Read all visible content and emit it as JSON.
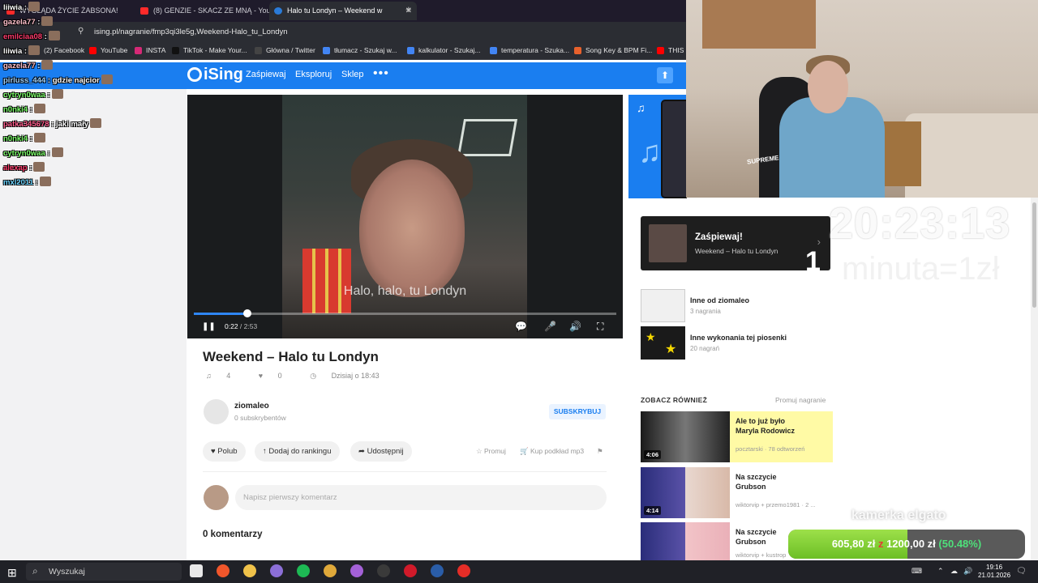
{
  "browser": {
    "tabs": [
      {
        "title": "WYGLĄDA ŻYCIE ŻABSONA!",
        "fav_color": "#ff2a2a"
      },
      {
        "title": "(8) GENZIE - SKACZ ZE MNĄ - YouTu",
        "fav_color": "#ff2a2a"
      },
      {
        "title": "Halo tu Londyn – Weekend w",
        "fav_color": "#2a7bd8"
      }
    ],
    "close_glyph": "✕",
    "new_tab": "+",
    "url": "ising.pl/nagranie/fmp3qi3le5g,Weekend-Halo_tu_Londyn",
    "url_icon": "⚲",
    "bookmarks": [
      {
        "label": "(2) Facebook",
        "color": "#1877f2"
      },
      {
        "label": "YouTube",
        "color": "#ff0000"
      },
      {
        "label": "INSTA",
        "color": "#d62976"
      },
      {
        "label": "TikTok - Make Your...",
        "color": "#111111"
      },
      {
        "label": "Główna / Twitter",
        "color": "#444444"
      },
      {
        "label": "tłumacz - Szukaj w...",
        "color": "#4285f4"
      },
      {
        "label": "kalkulator - Szukaj...",
        "color": "#4285f4"
      },
      {
        "label": "temperatura - Szuka...",
        "color": "#4285f4"
      },
      {
        "label": "Song Key & BPM Fi...",
        "color": "#e8612c"
      },
      {
        "label": "THIS is",
        "color": "#ff0000"
      }
    ]
  },
  "chat": [
    {
      "user": "liiwia",
      "sep": " :",
      "msg": "",
      "color": "#ffffff"
    },
    {
      "user": "gazela77",
      "sep": " :",
      "msg": "",
      "color": "#ffc0cb"
    },
    {
      "user": "emilciaa08",
      "sep": " :",
      "msg": "",
      "color": "#ff3b6b"
    },
    {
      "user": "liiwia",
      "sep": " :",
      "msg": "",
      "color": "#ffffff"
    },
    {
      "user": "gazela77",
      "sep": " :",
      "msg": "",
      "color": "#ffc0cb"
    },
    {
      "user": "pirluss_444",
      "sep": " :",
      "msg": " gdzie najcior",
      "color": "#9fd3ff"
    },
    {
      "user": "cytryn0waa",
      "sep": " :",
      "msg": "",
      "color": "#7cff6a"
    },
    {
      "user": "n0nki4",
      "sep": " :",
      "msg": "",
      "color": "#7cff6a"
    },
    {
      "user": "patka345678",
      "sep": " :",
      "msg": " jaki mały",
      "color": "#ff5a8c"
    },
    {
      "user": "n0nki4",
      "sep": " :",
      "msg": "",
      "color": "#7cff6a"
    },
    {
      "user": "cytryn0waa",
      "sep": " :",
      "msg": "",
      "color": "#7cff6a"
    },
    {
      "user": "alexap",
      "sep": " :",
      "msg": "",
      "color": "#ff3b6b"
    },
    {
      "user": "mxl2011",
      "sep": " :",
      "msg": "",
      "color": "#6ad4ff"
    }
  ],
  "site": {
    "logo": "iSing",
    "nav": [
      "Zaśpiewaj",
      "Eksploruj",
      "Sklep"
    ],
    "more": "•••",
    "upload_icon": "⬆"
  },
  "video": {
    "subtitle": "Halo, halo, tu Londyn",
    "current_time": "0:22",
    "duration": "2:53",
    "progress": 0.127,
    "pause_icon": "❚❚",
    "controls": [
      "💬",
      "🎤",
      "🔊",
      "⛶"
    ]
  },
  "song": {
    "title": "Weekend – Halo tu Londyn",
    "plays": "4",
    "likes": "0",
    "date": "Dzisiaj o 18:43",
    "stat_icons": [
      "♫",
      "♥",
      "◷"
    ]
  },
  "author": {
    "name": "ziomaleo",
    "subs": "0 subskrybentów",
    "subscribe": "SUBSKRYBUJ"
  },
  "actions": {
    "like": "♥ Polub",
    "rank": "↑ Dodaj do rankingu",
    "share": "➦ Udostępnij",
    "promote": "☆ Promuj",
    "buy": "🛒 Kup podkład mp3",
    "flag": "⚑"
  },
  "comments": {
    "placeholder": "Napisz pierwszy komentarz",
    "count_label": "0 komentarzy"
  },
  "sidebar": {
    "sing_card": {
      "title": "Zaśpiewaj!",
      "subtitle": "Weekend – Halo tu Londyn",
      "chevron": "›"
    },
    "related": [
      {
        "title": "Inne od ziomaleo",
        "sub": "3 nagrania"
      },
      {
        "title": "Inne wykonania tej piosenki",
        "sub": "20 nagrań"
      }
    ],
    "see_also_title": "ZOBACZ RÓWNIEŻ",
    "promote_link": "Promuj nagranie",
    "recommendations": [
      {
        "title": "Ale to już było\nMaryla Rodowicz",
        "meta": "pocztarski · 78 odtworzeń",
        "duration": "4:06",
        "highlighted": true
      },
      {
        "title": "Na szczycie\nGrubson",
        "meta": "wiktorvip + przemo1981 · 2 ...",
        "duration": "4:14",
        "highlighted": false
      },
      {
        "title": "Na szczycie\nGrubson",
        "meta": "wiktorvip + kustrop",
        "duration": "",
        "highlighted": false
      }
    ]
  },
  "overlay": {
    "clock": "20:23:13",
    "counter": "1",
    "rate": "minuta=1zł",
    "cam_label": "kamerka elgato",
    "cam_shirt_text": "SUPREME",
    "goal": {
      "current": "605,80 zł",
      "sep": "z",
      "target": "1200,00 zł",
      "percent_label": "(50.48%)",
      "fraction": 0.5048
    }
  },
  "taskbar": {
    "start_icon": "⊞",
    "search_icon": "⌕",
    "search_label": "Wyszukaj",
    "apps": [
      {
        "name": "file-icon",
        "color": "#e8e8e8"
      },
      {
        "name": "brave-icon",
        "color": "#f1562b"
      },
      {
        "name": "folder-icon",
        "color": "#f0c24a"
      },
      {
        "name": "chrome-icon",
        "color": "#8c6fd8"
      },
      {
        "name": "spotify-icon",
        "color": "#1db954"
      },
      {
        "name": "media-icon",
        "color": "#e0a93a"
      },
      {
        "name": "app-icon",
        "color": "#a461d8"
      },
      {
        "name": "obs-icon",
        "color": "#3a3a3a"
      },
      {
        "name": "opera-icon",
        "color": "#d11a2a"
      },
      {
        "name": "steam-icon",
        "color": "#2a5da8"
      },
      {
        "name": "youtube-icon",
        "color": "#e52d27"
      }
    ],
    "tray_icons": [
      "⌨",
      "⌃",
      "☁",
      "🔊"
    ],
    "time": "19:16",
    "date": "21.01.2026",
    "notif_icon": "🗨"
  }
}
